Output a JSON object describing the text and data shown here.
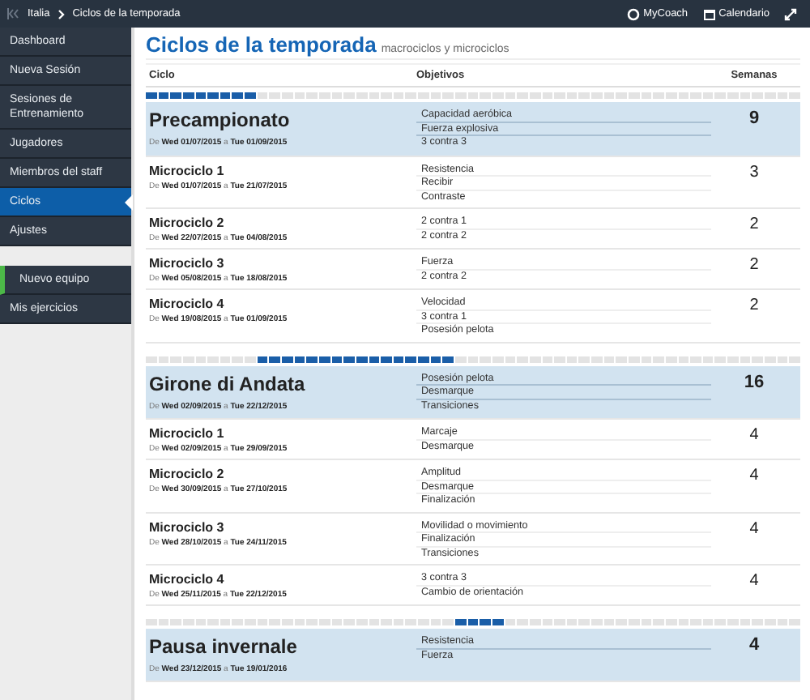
{
  "topbar": {
    "breadcrumb": [
      "Italia",
      "Ciclos de la temporada"
    ],
    "actions": [
      {
        "kind": "coach",
        "label": "MyCoach"
      },
      {
        "kind": "calendar",
        "label": "Calendario"
      },
      {
        "kind": "expand"
      }
    ]
  },
  "sidebar": {
    "items": [
      {
        "label": "Dashboard",
        "selected": false
      },
      {
        "label": "Nueva Sesión",
        "selected": false
      },
      {
        "label": "Sesiones de Entrenamiento",
        "selected": false
      },
      {
        "label": "Jugadores",
        "selected": false
      },
      {
        "label": "Miembros del staff",
        "selected": false
      },
      {
        "label": "Ciclos",
        "selected": true
      },
      {
        "label": "Ajustes",
        "selected": false
      }
    ],
    "secondary": [
      {
        "label": "Nuevo equipo",
        "highlighted": true
      },
      {
        "label": "Mis ejercicios",
        "highlighted": false
      }
    ]
  },
  "page": {
    "title": "Ciclos de la temporada",
    "subtitle": "macrociclos y microciclos"
  },
  "table": {
    "columns": [
      "Ciclo",
      "Objetivos",
      "Semanas"
    ],
    "cycles": [
      {
        "timeline": [
          true,
          true,
          true,
          true,
          true,
          true,
          true,
          true,
          true,
          false,
          false,
          false,
          false,
          false,
          false,
          false,
          false,
          false,
          false,
          false,
          false,
          false,
          false,
          false,
          false,
          false,
          false,
          false,
          false,
          false,
          false,
          false,
          false,
          false,
          false,
          false,
          false,
          false,
          false,
          false,
          false,
          false,
          false,
          false,
          false,
          false,
          false,
          false,
          false,
          false,
          false,
          false,
          false
        ],
        "name": "Precampionato",
        "dates": "De **Wed 01/07/2015** a **Tue 01/09/2015**",
        "objectives": [
          "Capacidad aeróbica",
          "Fuerza explosiva",
          "3 contra 3"
        ],
        "weeks": "9",
        "micro": [
          {
            "name": "Microciclo 1",
            "dates": "De **Wed 01/07/2015** a **Tue 21/07/2015**",
            "objectives": [
              "Resistencia",
              "Recibir",
              "Contraste"
            ],
            "weeks": "3"
          },
          {
            "name": "Microciclo 2",
            "dates": "De **Wed 22/07/2015** a **Tue 04/08/2015**",
            "objectives": [
              "2 contra 1",
              "2 contra 2"
            ],
            "weeks": "2"
          },
          {
            "name": "Microciclo 3",
            "dates": "De **Wed 05/08/2015** a **Tue 18/08/2015**",
            "objectives": [
              "Fuerza",
              "2 contra 2"
            ],
            "weeks": "2"
          },
          {
            "name": "Microciclo 4",
            "dates": "De **Wed 19/08/2015** a **Tue 01/09/2015**",
            "objectives": [
              "Velocidad",
              "3 contra 1",
              "Posesión pelota"
            ],
            "weeks": "2"
          }
        ]
      },
      {
        "timeline": [
          false,
          false,
          false,
          false,
          false,
          false,
          false,
          false,
          false,
          true,
          true,
          true,
          true,
          true,
          true,
          true,
          true,
          true,
          true,
          true,
          true,
          true,
          true,
          true,
          true,
          false,
          false,
          false,
          false,
          false,
          false,
          false,
          false,
          false,
          false,
          false,
          false,
          false,
          false,
          false,
          false,
          false,
          false,
          false,
          false,
          false,
          false,
          false,
          false,
          false,
          false,
          false,
          false
        ],
        "name": "Girone di Andata",
        "dates": "De **Wed 02/09/2015** a **Tue 22/12/2015**",
        "objectives": [
          "Posesión pelota",
          "Desmarque",
          "Transiciones"
        ],
        "weeks": "16",
        "micro": [
          {
            "name": "Microciclo 1",
            "dates": "De **Wed 02/09/2015** a **Tue 29/09/2015**",
            "objectives": [
              "Marcaje",
              "Desmarque"
            ],
            "weeks": "4"
          },
          {
            "name": "Microciclo 2",
            "dates": "De **Wed 30/09/2015** a **Tue 27/10/2015**",
            "objectives": [
              "Amplitud",
              "Desmarque",
              "Finalización"
            ],
            "weeks": "4"
          },
          {
            "name": "Microciclo 3",
            "dates": "De **Wed 28/10/2015** a **Tue 24/11/2015**",
            "objectives": [
              "Movilidad o movimiento",
              "Finalización",
              "Transiciones"
            ],
            "weeks": "4"
          },
          {
            "name": "Microciclo 4",
            "dates": "De **Wed 25/11/2015** a **Tue 22/12/2015**",
            "objectives": [
              "3 contra 3",
              "Cambio de orientación"
            ],
            "weeks": "4"
          }
        ]
      },
      {
        "timeline": [
          false,
          false,
          false,
          false,
          false,
          false,
          false,
          false,
          false,
          false,
          false,
          false,
          false,
          false,
          false,
          false,
          false,
          false,
          false,
          false,
          false,
          false,
          false,
          false,
          false,
          true,
          true,
          true,
          true,
          false,
          false,
          false,
          false,
          false,
          false,
          false,
          false,
          false,
          false,
          false,
          false,
          false,
          false,
          false,
          false,
          false,
          false,
          false,
          false,
          false,
          false,
          false,
          false
        ],
        "name": "Pausa invernale",
        "dates": "De **Wed 23/12/2015** a **Tue 19/01/2016**",
        "objectives": [
          "Resistencia",
          "Fuerza"
        ],
        "weeks": "4"
      }
    ]
  }
}
